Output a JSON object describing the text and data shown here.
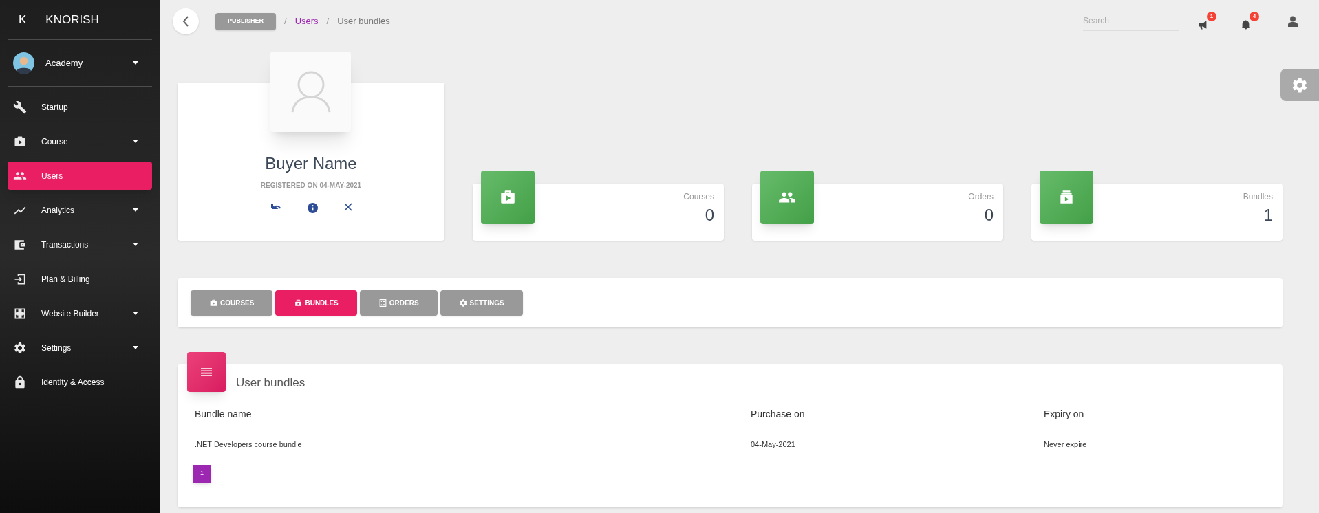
{
  "sidebar": {
    "brand": {
      "letter": "K",
      "name": "KNORISH"
    },
    "account": {
      "name": "Academy",
      "expandable": true
    },
    "items": [
      {
        "label": "Startup",
        "selected": false,
        "expandable": false
      },
      {
        "label": "Course",
        "selected": false,
        "expandable": true
      },
      {
        "label": "Users",
        "selected": true,
        "expandable": false
      },
      {
        "label": "Analytics",
        "selected": false,
        "expandable": true
      },
      {
        "label": "Transactions",
        "selected": false,
        "expandable": true
      },
      {
        "label": "Plan & Billing",
        "selected": false,
        "expandable": false
      },
      {
        "label": "Website Builder",
        "selected": false,
        "expandable": true
      },
      {
        "label": "Settings",
        "selected": false,
        "expandable": true
      },
      {
        "label": "Identity & Access",
        "selected": false,
        "expandable": false
      }
    ]
  },
  "topbar": {
    "breadcrumb": [
      {
        "label": "PUBLISHER",
        "kind": "badge"
      },
      {
        "label": "/",
        "kind": "separator"
      },
      {
        "label": "Users",
        "kind": "link"
      },
      {
        "label": "/",
        "kind": "separator"
      },
      {
        "label": "User bundles",
        "kind": "current"
      }
    ],
    "search": {
      "placeholder": "Search"
    },
    "notifications": [
      {
        "badge": "1"
      },
      {
        "badge": "4"
      }
    ]
  },
  "profile": {
    "name": "Buyer Name",
    "registered": "REGISTERED ON 04-MAY-2021"
  },
  "stats": [
    {
      "label": "Courses",
      "value": "0"
    },
    {
      "label": "Orders",
      "value": "0"
    },
    {
      "label": "Bundles",
      "value": "1"
    }
  ],
  "tabs": [
    {
      "label": "COURSES",
      "selected": false
    },
    {
      "label": "BUNDLES",
      "selected": true
    },
    {
      "label": "ORDERS",
      "selected": false
    },
    {
      "label": "SETTINGS",
      "selected": false
    }
  ],
  "table": {
    "title": "User bundles",
    "columns": [
      "Bundle name",
      "Purchase on",
      "Expiry on"
    ],
    "rows": [
      [
        ".NET Developers course bundle",
        "04-May-2021",
        "Never expire"
      ]
    ],
    "pages": [
      {
        "label": "1",
        "selected": true
      }
    ]
  }
}
